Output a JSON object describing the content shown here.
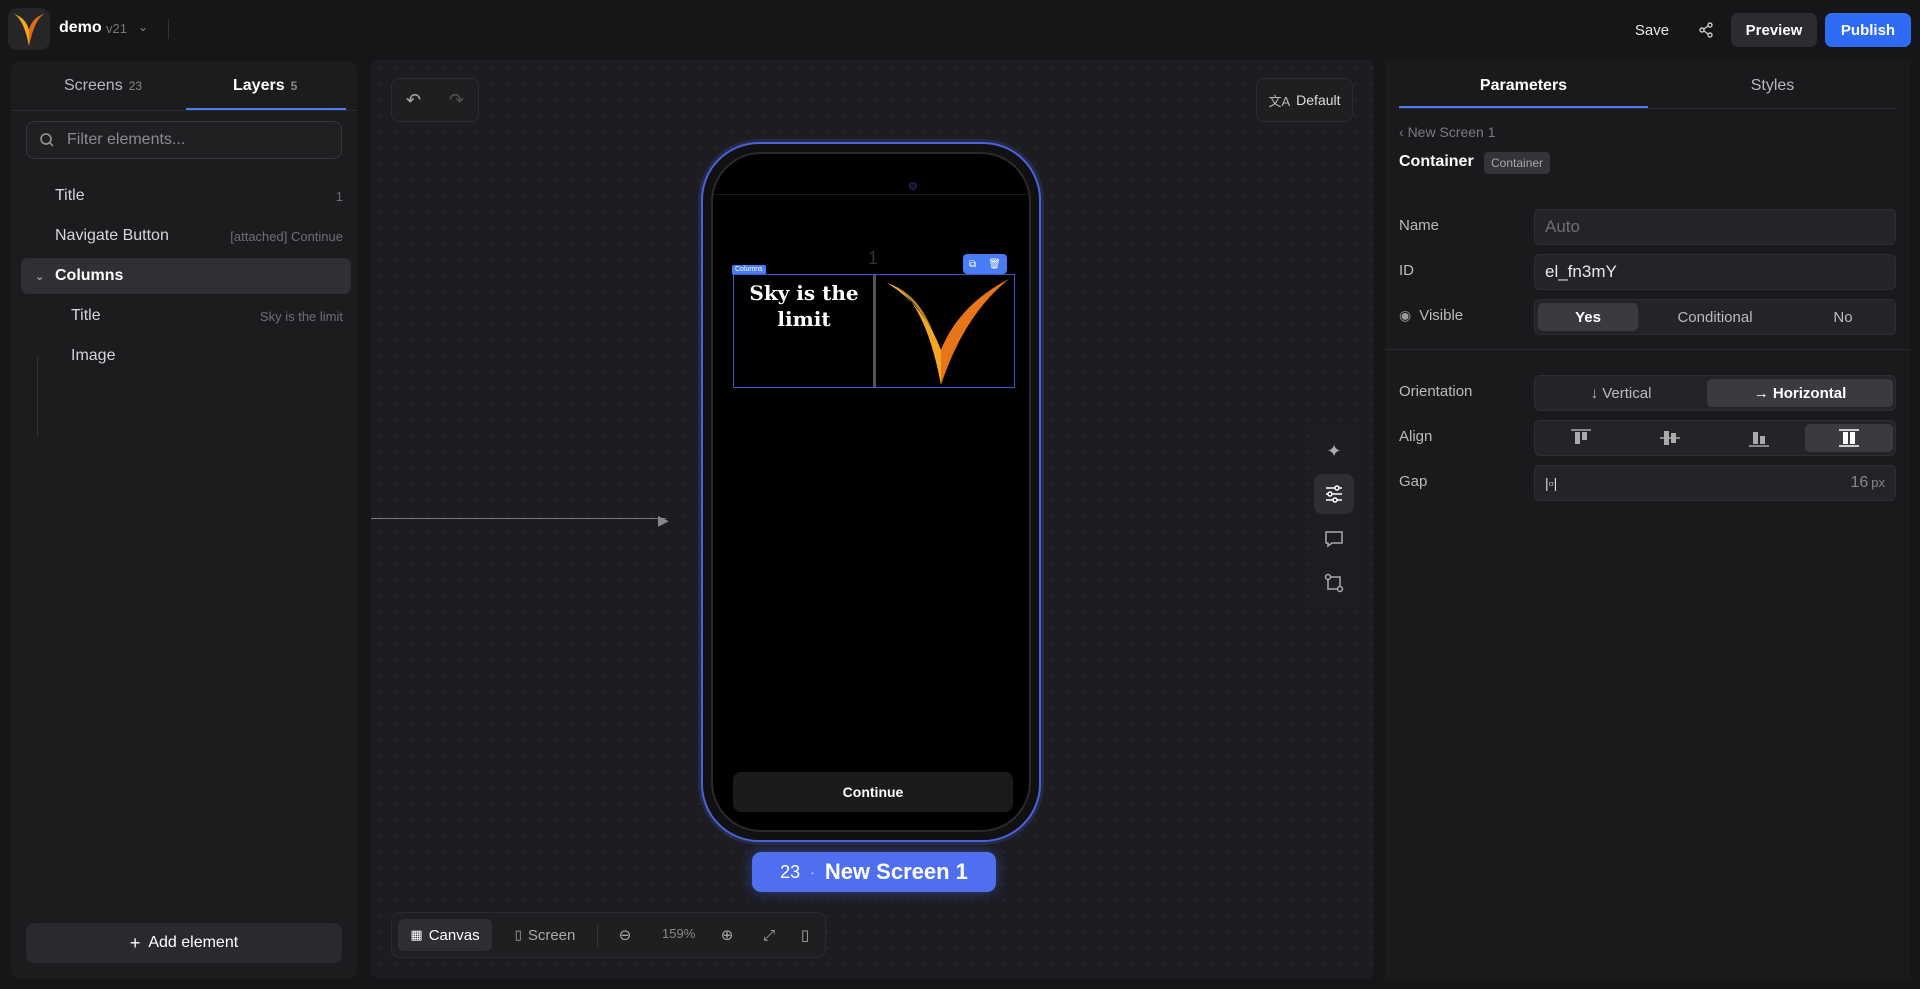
{
  "topbar": {
    "project_name": "demo",
    "version": "v21",
    "save_label": "Save",
    "preview_label": "Preview",
    "publish_label": "Publish",
    "colors": {
      "publish": "#2e6cf6",
      "accent": "#4b7cf5"
    }
  },
  "left_panel": {
    "tabs": [
      {
        "label": "Screens",
        "count": "23"
      },
      {
        "label": "Layers",
        "count": "5"
      }
    ],
    "filter_placeholder": "Filter elements...",
    "layers": [
      {
        "label": "Title",
        "meta": "1"
      },
      {
        "label": "Navigate Button",
        "meta": "[attached] Continue"
      },
      {
        "label": "Columns",
        "meta": ""
      },
      {
        "label": "Title",
        "meta": "Sky is the limit"
      },
      {
        "label": "Image",
        "meta": ""
      }
    ],
    "add_element_label": "Add element"
  },
  "canvas": {
    "locale_label": "Default",
    "phone": {
      "screen_number": "1",
      "columns_tag": "Columns",
      "title_text": "Sky is the limit",
      "continue_label": "Continue"
    },
    "screen_badge": {
      "number": "23",
      "name": "New Screen 1"
    },
    "bottom_bar": {
      "canvas_label": "Canvas",
      "screen_label": "Screen",
      "zoom": "159%"
    }
  },
  "right_panel": {
    "tabs": [
      "Parameters",
      "Styles"
    ],
    "breadcrumb": "New Screen 1",
    "element_title": "Container",
    "element_badge": "Container",
    "name_label": "Name",
    "name_placeholder": "Auto",
    "id_label": "ID",
    "id_value": "el_fn3mY",
    "visible_label": "Visible",
    "visible_options": [
      "Yes",
      "Conditional",
      "No"
    ],
    "visible_selected": "Yes",
    "orientation_label": "Orientation",
    "orientation_options": [
      "Vertical",
      "Horizontal"
    ],
    "orientation_selected": "Horizontal",
    "align_label": "Align",
    "gap_label": "Gap",
    "gap_value": "16",
    "gap_unit": "px"
  }
}
